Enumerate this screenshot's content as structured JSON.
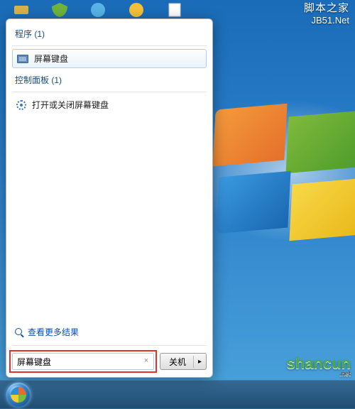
{
  "watermarks": {
    "top_line1": "脚本之家",
    "top_line2": "JB51.Net",
    "bottom": "shancun",
    "bottom_net": ".net"
  },
  "start_menu": {
    "programs_header": "程序 (1)",
    "program_item": "屏幕键盘",
    "control_panel_header": "控制面板 (1)",
    "control_panel_item": "打开或关闭屏幕键盘",
    "more_results": "查看更多结果",
    "search_value": "屏幕键盘",
    "shutdown_label": "关机"
  },
  "icons": {
    "keyboard": "keyboard-icon",
    "gear": "gear-icon",
    "search": "search-icon",
    "clear": "×",
    "arrow": "▸"
  }
}
